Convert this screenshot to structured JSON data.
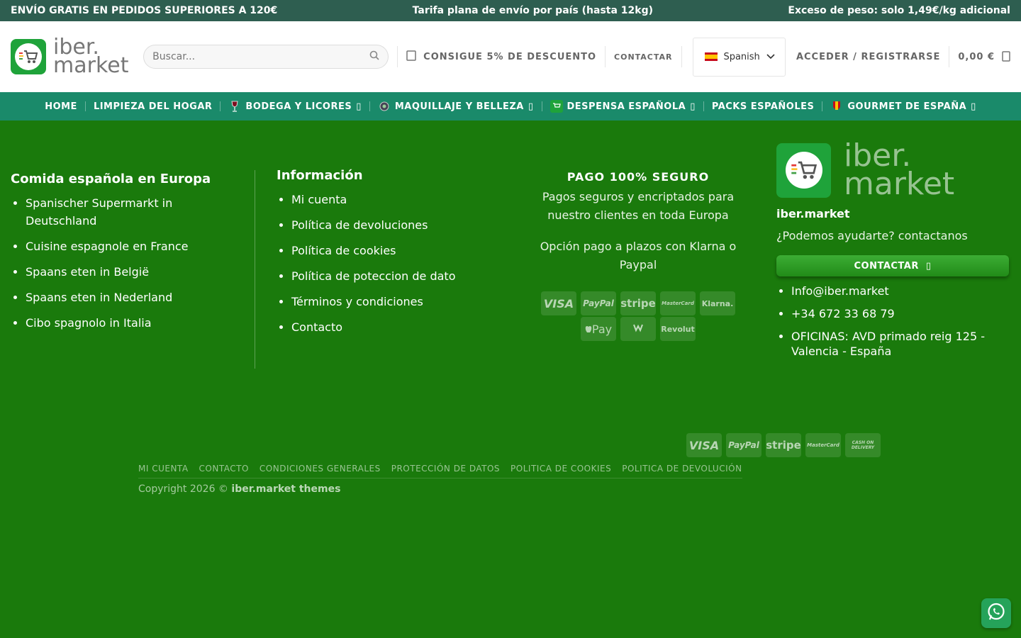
{
  "topbar": {
    "left": "ENVÍO GRATIS EN PEDIDOS SUPERIORES A 120€",
    "center": "Tarifa plana de envío por país (hasta 12kg)",
    "right": "Exceso de peso: solo 1,49€/kg adicional"
  },
  "header": {
    "logo_line1": "iber.",
    "logo_line2": "market",
    "search_placeholder": "Buscar...",
    "discount": "CONSIGUE 5% DE DESCUENTO",
    "contact": "CONTACTAR",
    "language": "Spanish",
    "login": "ACCEDER / REGISTRARSE",
    "cart": "0,00 €"
  },
  "nav": [
    {
      "label": "HOME",
      "dropdown": false,
      "icon": ""
    },
    {
      "label": "LIMPIEZA DEL HOGAR",
      "dropdown": false,
      "icon": ""
    },
    {
      "label": "BODEGA Y LICORES",
      "dropdown": true,
      "icon": "wine-icon"
    },
    {
      "label": "MAQUILLAJE Y BELLEZA",
      "dropdown": true,
      "icon": "beauty-icon"
    },
    {
      "label": "DESPENSA ESPAÑOLA",
      "dropdown": true,
      "icon": "cart-icon"
    },
    {
      "label": "PACKS ESPAÑOLES",
      "dropdown": false,
      "icon": ""
    },
    {
      "label": "GOURMET DE ESPAÑA",
      "dropdown": true,
      "icon": "spain-flag-icon"
    }
  ],
  "footer": {
    "col1": {
      "title": "Comida española en Europa",
      "items": [
        "Spanischer Supermarkt in Deutschland",
        "Cuisine espagnole en France",
        "Spaans eten in België",
        "Spaans eten in Nederland",
        "Cibo spagnolo in Italia"
      ]
    },
    "col2": {
      "title": "Información",
      "items": [
        "Mi cuenta",
        "Política de devoluciones",
        "Política de cookies",
        "Política de poteccion de dato",
        "Términos y condiciones",
        "Contacto"
      ]
    },
    "col3": {
      "title": "PAGO 100% SEGURO",
      "text1": "Pagos seguros y encriptados para nuestro clientes en toda Europa",
      "text2": "Opción pago a plazos con Klarna o Paypal",
      "cards_row1": [
        "VISA",
        "PayPal",
        "stripe",
        "MasterCard",
        "Klarna."
      ],
      "cards_row2": [
        "Pay",
        "Bizum",
        "Revolut"
      ]
    },
    "col4": {
      "logo_line1": "iber.",
      "logo_line2": "market",
      "name": "iber.market",
      "help": "¿Podemos ayudarte? contactanos",
      "button": "CONTACTAR",
      "items": [
        "Info@iber.market",
        "+34 672 33 68 79",
        "OFICINAS: AVD primado reig 125 - Valencia - España"
      ]
    },
    "bottom_cards": [
      "VISA",
      "PayPal",
      "stripe",
      "MasterCard",
      "CASH ON DELIVERY"
    ],
    "links": [
      "MI CUENTA",
      "CONTACTO",
      "CONDICIONES GENERALES",
      "PROTECCIÓN DE DATOS",
      "POLITICA DE COOKIES",
      "POLITICA DE DEVOLUCIÓN"
    ],
    "copyright_prefix": "Copyright 2026 ©",
    "copyright_brand": "iber.market themes"
  },
  "colors": {
    "topbar": "#2e5e50",
    "nav": "#1a8a6a",
    "footer": "#1a7a0c",
    "brand": "#1fa33a"
  }
}
